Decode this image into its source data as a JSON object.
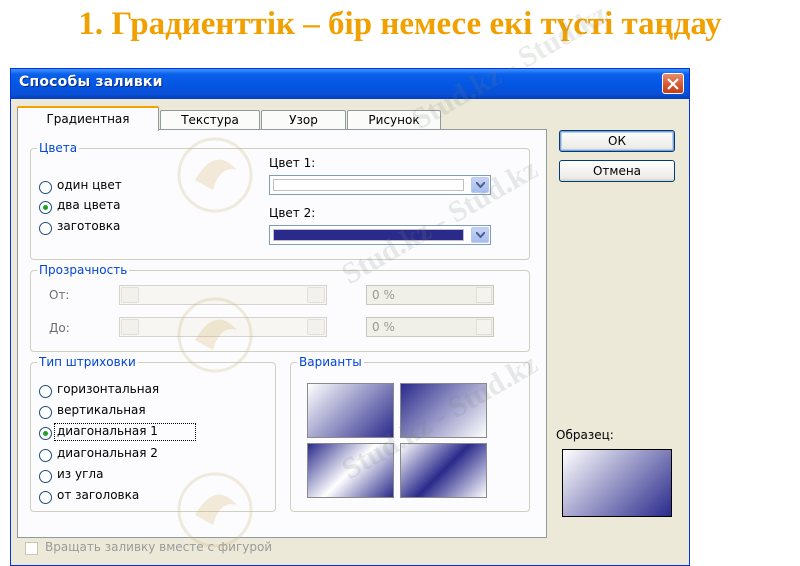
{
  "headline": "1. Градиенттік – бір немесе екі түсті таңдау",
  "watermark": "Stud.kz - Stud.kz",
  "dialog": {
    "title": "Способы заливки",
    "tabs": [
      "Градиентная",
      "Текстура",
      "Узор",
      "Рисунок"
    ],
    "active_tab": "Градиентная",
    "colors_group": {
      "label": "Цвета",
      "options": [
        "один цвет",
        "два цвета",
        "заготовка"
      ],
      "selected": "два цвета",
      "color1_label": "Цвет 1:",
      "color2_label": "Цвет 2:",
      "color1_value": "#ffffff",
      "color2_value": "#2a2a8c"
    },
    "transparency_group": {
      "label": "Прозрачность",
      "from_label": "От:",
      "to_label": "До:",
      "from_value": "0 %",
      "to_value": "0 %"
    },
    "shading_group": {
      "label": "Тип штриховки",
      "options": [
        "горизонтальная",
        "вертикальная",
        "диагональная 1",
        "диагональная 2",
        "из угла",
        "от заголовка"
      ],
      "selected": "диагональная 1"
    },
    "variants_group": {
      "label": "Варианты"
    },
    "buttons": {
      "ok": "ОК",
      "cancel": "Отмена"
    },
    "sample_label": "Образец:",
    "rotate_checkbox_label": "Вращать заливку вместе с фигурой",
    "accent_color": "#0046d5"
  }
}
